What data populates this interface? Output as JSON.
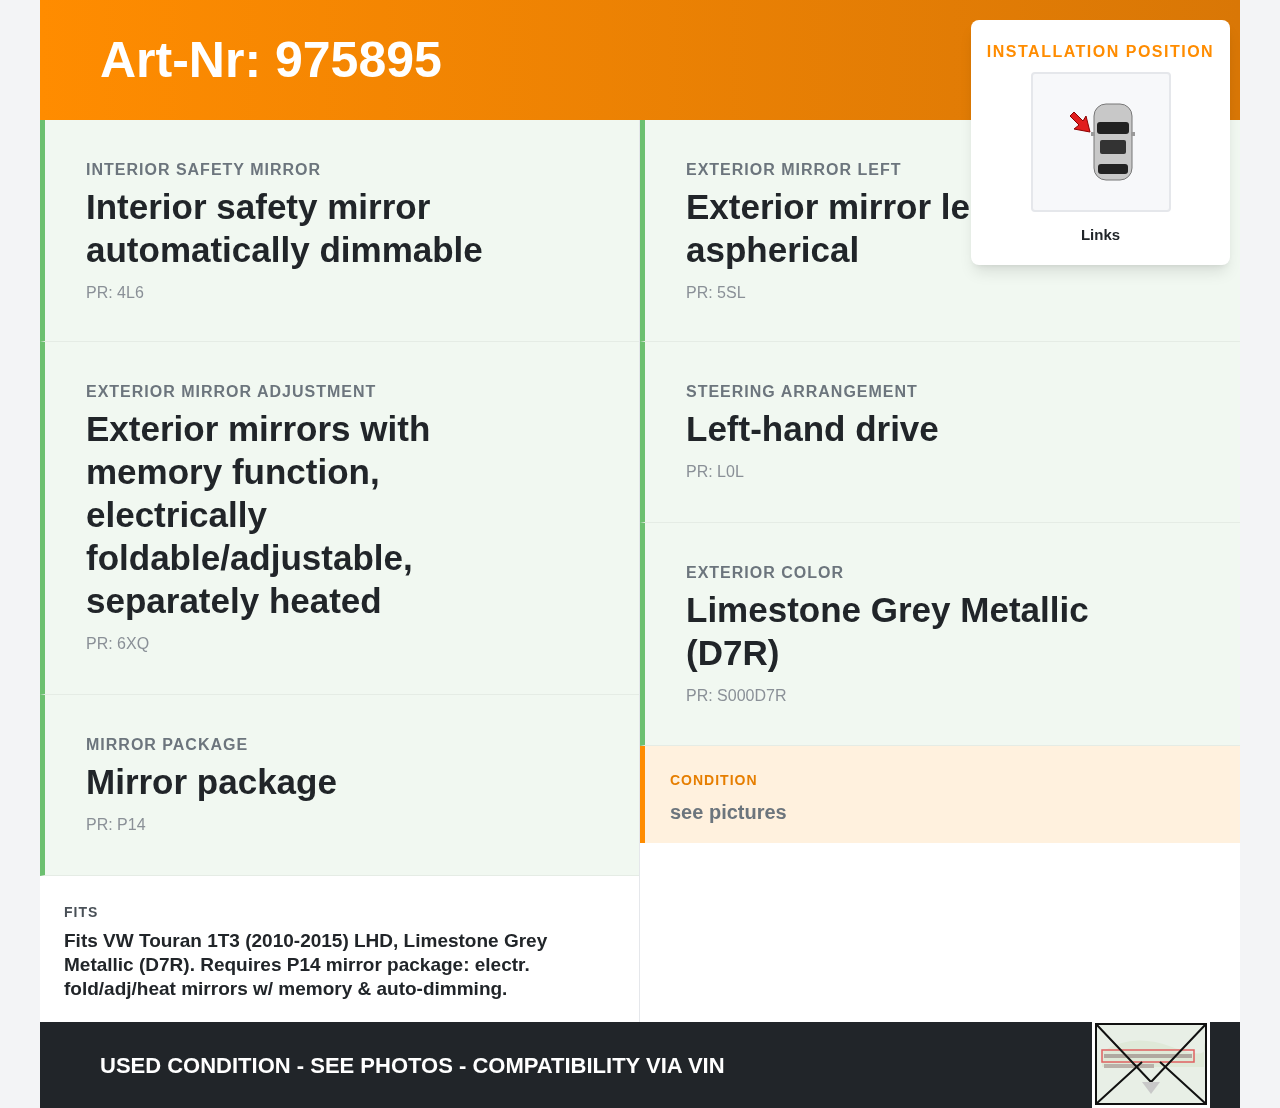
{
  "header": {
    "title": "Art-Nr: 975895"
  },
  "installation_position": {
    "heading": "INSTALLATION POSITION",
    "caption": "Links"
  },
  "left_options": [
    {
      "label": "INTERIOR SAFETY MIRROR",
      "title_lines": [
        "Interior safety mirror automatically dimmable"
      ],
      "pr": "PR: 4L6"
    },
    {
      "label": "EXTERIOR MIRROR ADJUSTMENT",
      "title_lines": [
        "Exterior mirrors with memory function, electrically foldable/adjustable, separately heated"
      ],
      "pr": "PR: 6XQ"
    },
    {
      "label": "MIRROR PACKAGE",
      "title_lines": [
        "Mirror package"
      ],
      "pr": "PR: P14"
    }
  ],
  "right_options": [
    {
      "label": "EXTERIOR MIRROR LEFT",
      "title_lines": [
        "Exterior mirror le",
        "aspherical"
      ],
      "pr": "PR: 5SL"
    },
    {
      "label": "STEERING ARRANGEMENT",
      "title_lines": [
        "Left-hand drive"
      ],
      "pr": "PR: L0L"
    },
    {
      "label": "EXTERIOR COLOR",
      "title_lines": [
        "Limestone Grey Metallic (D7R)"
      ],
      "pr": "PR: S000D7R"
    }
  ],
  "condition": {
    "label": "CONDITION",
    "value": "see pictures"
  },
  "fits": {
    "label": "FITS",
    "text": "Fits VW Touran 1T3 (2010-2015) LHD, Limestone Grey Metallic (D7R). Requires P14 mirror package: electr. fold/adj/heat mirrors w/ memory & auto-dimming."
  },
  "footer": {
    "text": "USED CONDITION - SEE PHOTOS - COMPATIBILITY VIA VIN"
  }
}
